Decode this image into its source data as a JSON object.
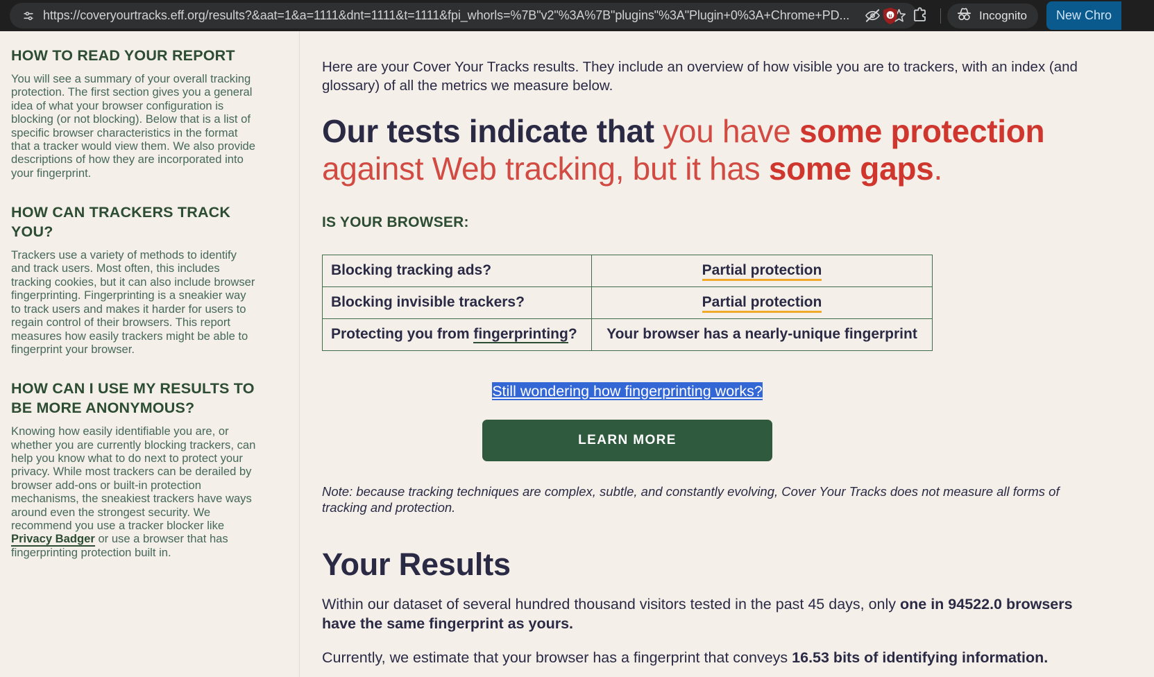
{
  "browser": {
    "url": "https://coveryourtracks.eff.org/results?&aat=1&a=1111&dnt=1111&t=1111&fpi_whorls=%7B\"v2\"%3A%7B\"plugins\"%3A\"Plugin+0%3A+Chrome+PD...",
    "site_info_icon": "tune-icon",
    "hide_password_icon": "eye-slash-icon",
    "bookmark_icon": "star-icon",
    "extension_icon": "ublock-origin-icon",
    "extensions_puzzle_icon": "puzzle-piece-icon",
    "incognito_icon": "incognito-spy-icon",
    "incognito_label": "Incognito",
    "new_chrome_label": "New Chro"
  },
  "sidebar": {
    "sections": [
      {
        "heading": "HOW TO READ YOUR REPORT",
        "body": "You will see a summary of your overall tracking protection. The first section gives you a general idea of what your browser configuration is blocking (or not blocking). Below that is a list of specific browser characteristics in the format that a tracker would view them. We also provide descriptions of how they are incorporated into your fingerprint."
      },
      {
        "heading": "HOW CAN TRACKERS TRACK YOU?",
        "body": "Trackers use a variety of methods to identify and track users. Most often, this includes tracking cookies, but it can also include browser fingerprinting. Fingerprinting is a sneakier way to track users and makes it harder for users to regain control of their browsers. This report measures how easily trackers might be able to fingerprint your browser."
      },
      {
        "heading": "HOW CAN I USE MY RESULTS TO BE MORE ANONYMOUS?",
        "body_before_link": "Knowing how easily identifiable you are, or whether you are currently blocking trackers, can help you know what to do next to protect your privacy. While most trackers can be derailed by browser add-ons or built-in protection mechanisms, the sneakiest trackers have ways around even the strongest security. We recommend you use a tracker blocker like ",
        "link_text": "Privacy Badger",
        "body_after_link": " or use a browser that has fingerprinting protection built in."
      }
    ]
  },
  "main": {
    "intro": "Here are your Cover Your Tracks results. They include an overview of how visible you are to trackers, with an index (and glossary) of all the metrics we measure below.",
    "verdict": {
      "part1_dark": "Our tests indicate that ",
      "part2_red": "you have ",
      "part3_red_bold": "some protection",
      "part4_red": " against Web tracking, but it has ",
      "part5_red_bold": "some gaps",
      "part6_red": "."
    },
    "is_your_browser_label": "IS YOUR BROWSER:",
    "table": {
      "rows": [
        {
          "question": "Blocking tracking ads?",
          "answer": "Partial protection",
          "answer_style": "amber-underline"
        },
        {
          "question": "Blocking invisible trackers?",
          "answer": "Partial protection",
          "answer_style": "amber-underline"
        },
        {
          "question_before_link": "Protecting you from ",
          "question_link": "fingerprinting",
          "question_after_link": "?",
          "answer": "Your browser has a nearly-unique fingerprint",
          "answer_style": "plain"
        }
      ]
    },
    "wonder_link": "Still wondering how fingerprinting works?",
    "learn_more_label": "LEARN MORE",
    "note": "Note: because tracking techniques are complex, subtle, and constantly evolving, Cover Your Tracks does not measure all forms of tracking and protection.",
    "your_results_heading": "Your Results",
    "result_1": {
      "before": "Within our dataset of several hundred thousand visitors tested in the past 45 days, only ",
      "bold": "one in 94522.0 browsers have the same fingerprint as yours.",
      "after": ""
    },
    "result_2": {
      "before": "Currently, we estimate that your browser has a fingerprint that conveys ",
      "bold": "16.53 bits of identifying information.",
      "after": ""
    }
  },
  "colors": {
    "page_bg": "#f4efe9",
    "chrome_bg": "#1f1f1f",
    "green_heading": "#2c4c33",
    "green_body": "#46685a",
    "dark_navy": "#2b2a45",
    "red": "#d14b43",
    "red_bold": "#cf372e",
    "amber_underline": "#f0a92b",
    "button_green": "#2f5a3e",
    "selection_blue": "#3367d6",
    "table_border": "#3f6b4a"
  }
}
